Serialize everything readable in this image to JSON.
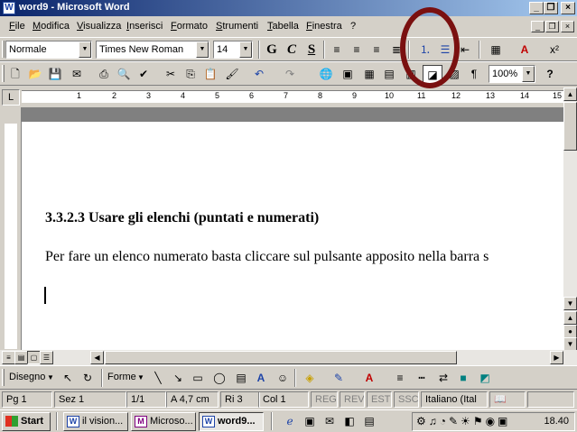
{
  "window": {
    "title": "word9 - Microsoft Word",
    "min_glyph": "_",
    "restore_glyph": "❐",
    "close_glyph": "×"
  },
  "menu": {
    "items": [
      "File",
      "Modifica",
      "Visualizza",
      "Inserisci",
      "Formato",
      "Strumenti",
      "Tabella",
      "Finestra",
      "?"
    ]
  },
  "format_toolbar": {
    "style": "Normale",
    "font": "Times New Roman",
    "size": "14",
    "bold": "G",
    "italic": "C",
    "underline": "S",
    "font_color_letter": "A",
    "superscript": "x²"
  },
  "standard_toolbar": {
    "zoom": "100%",
    "help": "?",
    "paragraph_mark": "¶"
  },
  "ruler": {
    "corner": "L",
    "numbers": [
      "1",
      "2",
      "3",
      "4",
      "5",
      "6",
      "7",
      "8",
      "9",
      "10",
      "11",
      "12",
      "13",
      "14",
      "15"
    ]
  },
  "document": {
    "heading": "3.3.2.3 Usare gli elenchi (puntati e numerati)",
    "body": "Per fare un elenco numerato basta cliccare sul pulsante apposito nella barra s"
  },
  "drawing_toolbar": {
    "draw_label": "Disegno",
    "shapes_label": "Forme"
  },
  "status": {
    "page": "Pg 1",
    "section": "Sez 1",
    "pages": "1/1",
    "at": "A  4,7 cm",
    "line": "Ri  3",
    "column": "Col  1",
    "rec": "REG",
    "trk": "REV",
    "ext": "EST",
    "ovr": "SSC",
    "language": "Italiano (Ital"
  },
  "taskbar": {
    "start": "Start",
    "tasks": [
      {
        "label": "il vision..."
      },
      {
        "label": "Microso..."
      },
      {
        "label": "word9..."
      }
    ],
    "clock": "18.40"
  },
  "colors": {
    "title_bar": "#0a246a",
    "highlight_ring": "#7a1010",
    "face": "#d4d0c8"
  }
}
